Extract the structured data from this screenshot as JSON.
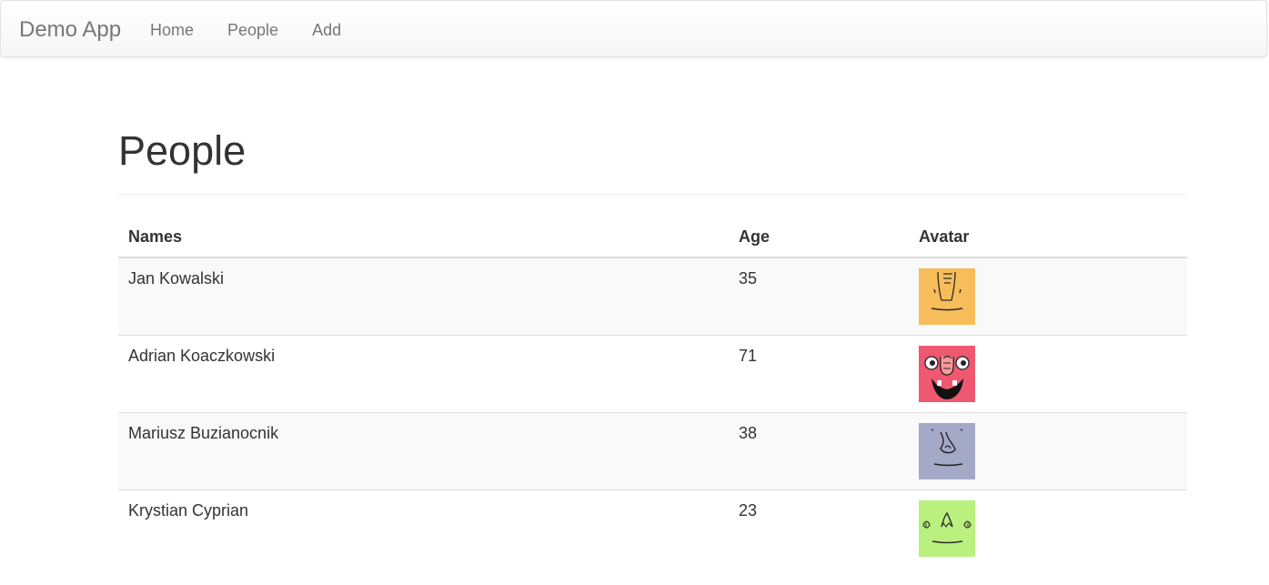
{
  "app": {
    "brand": "Demo App",
    "nav": [
      {
        "label": "Home"
      },
      {
        "label": "People"
      },
      {
        "label": "Add"
      }
    ]
  },
  "page": {
    "title": "People"
  },
  "table": {
    "headers": {
      "names": "Names",
      "age": "Age",
      "avatar": "Avatar"
    },
    "rows": [
      {
        "name": "Jan Kowalski",
        "age": "35",
        "avatar_icon": "orange-face-avatar-icon",
        "avatar_color": "#f7bd5b"
      },
      {
        "name": "Adrian Koaczkowski",
        "age": "71",
        "avatar_icon": "red-face-avatar-icon",
        "avatar_color": "#ee5870"
      },
      {
        "name": "Mariusz Buzianocnik",
        "age": "38",
        "avatar_icon": "lavender-face-avatar-icon",
        "avatar_color": "#a5a9c8"
      },
      {
        "name": "Krystian Cyprian",
        "age": "23",
        "avatar_icon": "green-face-avatar-icon",
        "avatar_color": "#b9f07e"
      }
    ]
  }
}
